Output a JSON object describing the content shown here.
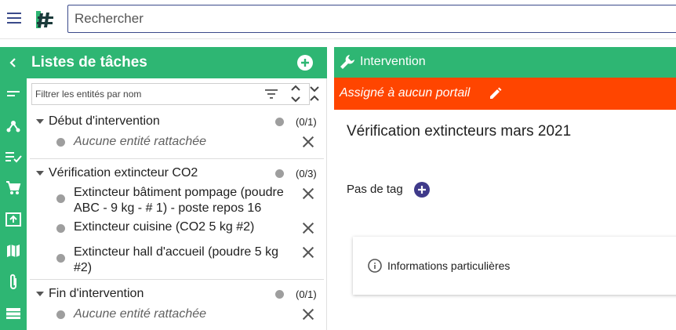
{
  "search": {
    "placeholder": "Rechercher"
  },
  "tasks": {
    "title": "Listes de tâches",
    "filter_placeholder": "Filtrer les entités par nom",
    "groups": [
      {
        "title": "Début d'intervention",
        "count": "(0/1)",
        "items": [
          {
            "text": "Aucune entité rattachée"
          }
        ]
      },
      {
        "title": "Vérification extincteur CO2",
        "count": "(0/3)",
        "items": [
          {
            "line1": "Extincteur bâtiment pompage (poudre",
            "line2": "ABC - 9 kg - # 1) - poste repos 16"
          },
          {
            "line1": "Extincteur cuisine (CO2 5 kg #2)"
          },
          {
            "line1": "Extincteur hall d'accueil (poudre 5 kg",
            "line2": "#2)"
          }
        ]
      },
      {
        "title": "Fin d'intervention",
        "count": "(0/1)",
        "items": [
          {
            "text": "Aucune entité rattachée"
          }
        ]
      }
    ]
  },
  "intervention": {
    "header": "Intervention",
    "portal": "Assigné à aucun portail",
    "title": "Vérification extincteurs mars 2021",
    "tag_label": "Pas de tag",
    "info_label": "Informations particulières"
  },
  "icons": {
    "rail": [
      "chevron-left-icon",
      "short-text-icon",
      "graph-icon",
      "checklist-icon",
      "cart-icon",
      "upload-icon",
      "map-icon",
      "attachment-icon",
      "list-icon"
    ]
  },
  "colors": {
    "green": "#2eb673",
    "orange": "#ff4500",
    "purple": "#3f3a8a",
    "navy": "#3a4a8a"
  }
}
